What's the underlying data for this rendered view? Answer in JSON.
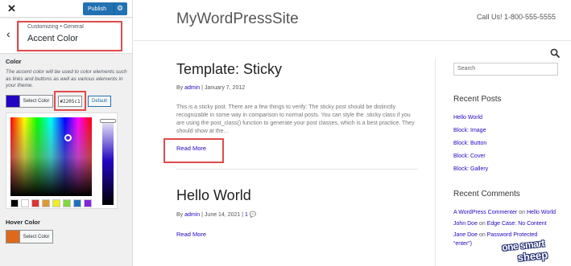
{
  "customizer": {
    "publish_label": "Publish",
    "breadcrumb": "Customizing • General",
    "section_title": "Accent Color",
    "color_label": "Color",
    "color_description": "The accent color will be used to color elements such as links and buttons as well as various elements in your theme.",
    "accent_color": "#2205c1",
    "select_color_label": "Select Color",
    "hex_value": "#2205c1",
    "default_label": "Default",
    "palette": [
      "#000000",
      "#ffffff",
      "#dd3333",
      "#dd9933",
      "#eeee22",
      "#81d742",
      "#1e73be",
      "#8224e3"
    ],
    "hover_label": "Hover Color",
    "hover_color": "#dd6a1c",
    "hover_select_label": "Select Color"
  },
  "preview": {
    "site_title": "MyWordPressSite",
    "call_us": "Call Us! 1-800-555-5555",
    "posts": [
      {
        "title": "Template: Sticky",
        "by": "By",
        "author": "admin",
        "date": "January 7, 2012",
        "excerpt": "This is a sticky post. There are a few things to verify: The sticky post should be distinctly recognizable in some way in comparison to normal posts. You can style the .sticky class if you are using the post_class() function to generate your post classes, which is a best practice. They should show at the…",
        "read_more": "Read More"
      },
      {
        "title": "Hello World",
        "by": "By",
        "author": "admin",
        "date": "June 14, 2021",
        "comments": "1",
        "read_more": "Read More"
      }
    ],
    "sidebar": {
      "search_placeholder": "Search",
      "recent_posts_title": "Recent Posts",
      "recent_posts": [
        "Hello World",
        "Block: Image",
        "Block: Button",
        "Block: Cover",
        "Block: Gallery"
      ],
      "recent_comments_title": "Recent Comments",
      "comments": [
        {
          "author": "A WordPress Commenter",
          "on": "on",
          "post": "Hello World"
        },
        {
          "author": "John Doe",
          "on": "on",
          "post": "Edge Case: No Content"
        },
        {
          "author": "Jane Doe",
          "on": "on",
          "post": "Password Protected",
          "post_rest": "“enter”)"
        }
      ]
    }
  },
  "watermark": {
    "line1": "one smart",
    "line2": "sheep"
  }
}
